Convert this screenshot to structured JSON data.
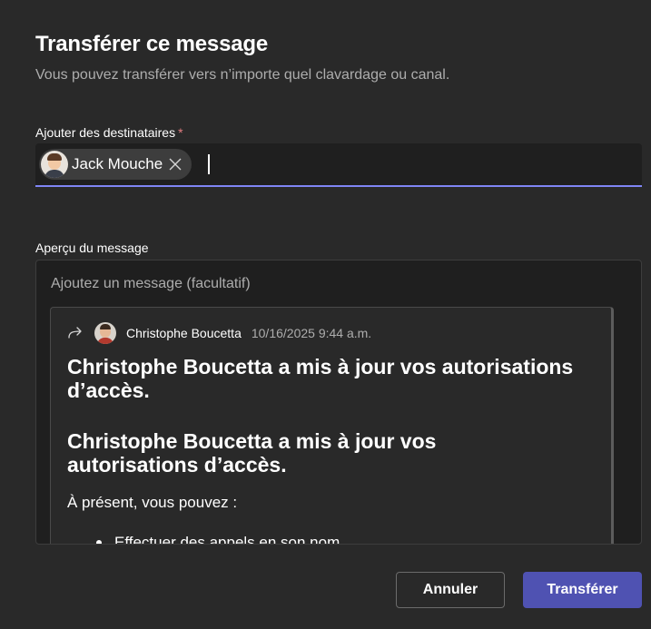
{
  "dialog": {
    "title": "Transférer ce message",
    "subtitle": "Vous pouvez transférer vers n’importe quel clavardage ou canal."
  },
  "recipients": {
    "label": "Ajouter des destinataires",
    "required_marker": "*",
    "chips": [
      {
        "name": "Jack Mouche"
      }
    ]
  },
  "preview": {
    "label": "Aperçu du message",
    "message_placeholder": "Ajoutez un message (facultatif)",
    "quote": {
      "author": "Christophe Boucetta",
      "timestamp": "10/16/2025 9:44 a.m.",
      "heading1": "Christophe Boucetta a mis à jour vos autorisations d’accès.",
      "heading2": "Christophe Boucetta a mis à jour vos autorisations d’accès.",
      "body": "À présent, vous pouvez :",
      "bullets": [
        "Effectuer des appels en son nom"
      ]
    }
  },
  "actions": {
    "cancel_label": "Annuler",
    "forward_label": "Transférer"
  },
  "colors": {
    "background": "#292929",
    "field_background": "#1f1f1f",
    "accent": "#4f52b2",
    "focus_underline": "#7f85f5",
    "required": "#e37d80"
  }
}
